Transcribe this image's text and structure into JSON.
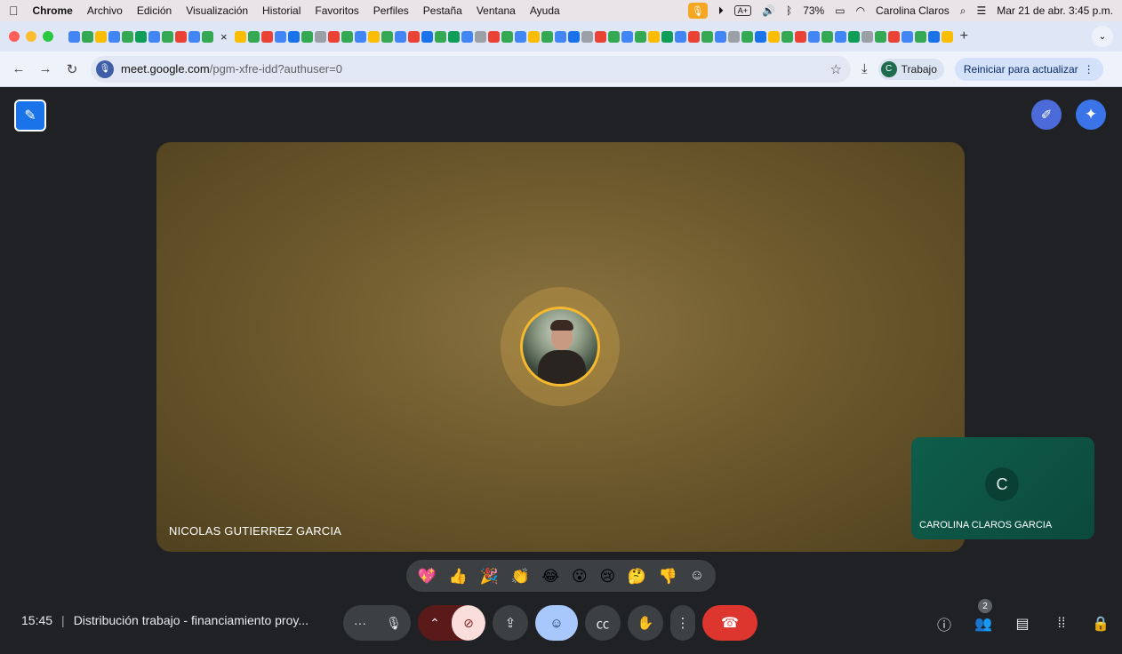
{
  "menubar": {
    "apple_icon": "apple-icon",
    "items": [
      "Chrome",
      "Archivo",
      "Edición",
      "Visualización",
      "Historial",
      "Favoritos",
      "Perfiles",
      "Pestaña",
      "Ventana",
      "Ayuda"
    ],
    "battery": "73%",
    "user": "Carolina Claros",
    "datetime": "Mar 21 de abr.  3:45 p.m."
  },
  "browser": {
    "url_host": "meet.google.com",
    "url_path": "/pgm-xfre-idd?authuser=0",
    "profile_initial": "C",
    "profile_label": "Trabajo",
    "restart_label": "Reiniciar para actualizar",
    "tab_colors": [
      "#4285f4",
      "#34a853",
      "#fbbc04",
      "#4285f4",
      "#34a853",
      "#0f9d58",
      "#4285f4",
      "#34a853",
      "#ea4335",
      "#4285f4",
      "#34a853",
      "#fbbc04",
      "#34a853",
      "#ea4335",
      "#4285f4",
      "#1a73e8",
      "#34a853",
      "#9aa0a6",
      "#ea4335",
      "#34a853",
      "#4285f4",
      "#fbbc04",
      "#34a853",
      "#4285f4",
      "#ea4335",
      "#1a73e8",
      "#34a853",
      "#0f9d58",
      "#4285f4",
      "#9aa0a6",
      "#ea4335",
      "#34a853",
      "#4285f4",
      "#fbbc04",
      "#34a853",
      "#4285f4",
      "#1a73e8",
      "#9aa0a6",
      "#ea4335",
      "#34a853",
      "#4285f4",
      "#34a853",
      "#fbbc04",
      "#0f9d58",
      "#4285f4",
      "#ea4335",
      "#34a853",
      "#4285f4",
      "#9aa0a6",
      "#34a853",
      "#1a73e8",
      "#fbbc04",
      "#34a853",
      "#ea4335",
      "#4285f4",
      "#34a853",
      "#4285f4",
      "#0f9d58",
      "#9aa0a6",
      "#34a853",
      "#ea4335",
      "#4285f4",
      "#34a853",
      "#1a73e8",
      "#fbbc04"
    ]
  },
  "meet": {
    "main_participant": "NICOLAS GUTIERREZ GARCIA",
    "self_participant": "CAROLINA CLAROS GARCIA",
    "self_initial": "C",
    "reactions": [
      "💖",
      "👍",
      "🎉",
      "👏",
      "😂",
      "😮",
      "😢",
      "🤔",
      "👎"
    ],
    "time": "15:45",
    "separator": "|",
    "meeting_title": "Distribución trabajo - financiamiento proy...",
    "participants_count": "2"
  }
}
